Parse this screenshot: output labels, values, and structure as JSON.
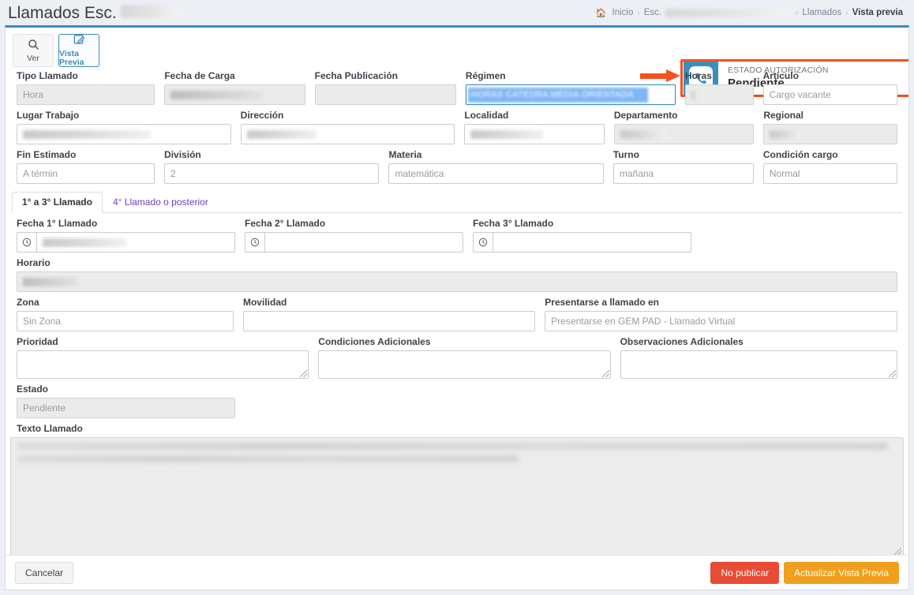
{
  "header": {
    "title_prefix": "Llamados Esc.",
    "title_redacted": true
  },
  "breadcrumb": {
    "home_icon": "home-icon",
    "items": [
      {
        "label": "Inicio",
        "active": false
      },
      {
        "label": "Esc.",
        "active": false,
        "redacted": true
      },
      {
        "label": "Llamados",
        "active": false
      },
      {
        "label": "Vista previa",
        "active": true
      }
    ],
    "separator": "›"
  },
  "toolbar": {
    "buttons": [
      {
        "icon": "search-icon",
        "label": "Ver",
        "active": false
      },
      {
        "icon": "edit-document-icon",
        "label": "Vista Previa",
        "active": true
      }
    ]
  },
  "status_callout": {
    "icon": "phone-icon",
    "label": "ESTADO AUTORIZACIÓN",
    "value": "Pendiente",
    "highlight_color": "#f4511e",
    "icon_bg_color": "#3c8dbc",
    "arrow_icon": "right-arrow-annotation"
  },
  "fields": {
    "tipo_llamado": {
      "label": "Tipo Llamado",
      "value": "Hora",
      "readonly": true
    },
    "fecha_carga": {
      "label": "Fecha de Carga",
      "value": "",
      "readonly": true,
      "redacted": true
    },
    "fecha_publicacion": {
      "label": "Fecha Publicación",
      "value": "",
      "readonly": true
    },
    "regimen": {
      "label": "Régimen",
      "value": "",
      "focused": true,
      "selected_text_redacted": true
    },
    "horas": {
      "label": "Horas",
      "value": "3",
      "readonly": true,
      "redacted": true
    },
    "articulo": {
      "label": "Artículo",
      "value": "Cargo vacante",
      "readonly": false
    },
    "lugar_trabajo": {
      "label": "Lugar Trabajo",
      "value": "",
      "redacted": true
    },
    "direccion": {
      "label": "Dirección",
      "value": "",
      "redacted": true
    },
    "localidad": {
      "label": "Localidad",
      "value": "",
      "redacted": true
    },
    "departamento": {
      "label": "Departamento",
      "value": "",
      "readonly": true,
      "redacted": true
    },
    "regional": {
      "label": "Regional",
      "value": "",
      "readonly": true,
      "redacted": true
    },
    "fin_estimado": {
      "label": "Fin Estimado",
      "value": "A términ"
    },
    "division": {
      "label": "División",
      "value": "2"
    },
    "materia": {
      "label": "Materia",
      "value": "matemática"
    },
    "turno": {
      "label": "Turno",
      "value": "mañana"
    },
    "condicion_cargo": {
      "label": "Condición cargo",
      "value": "Normal"
    },
    "fecha_1_llamado": {
      "label": "Fecha 1° Llamado",
      "value": "",
      "redacted": true,
      "icon": "clock-icon"
    },
    "fecha_2_llamado": {
      "label": "Fecha 2° Llamado",
      "value": "",
      "icon": "clock-icon"
    },
    "fecha_3_llamado": {
      "label": "Fecha 3° Llamado",
      "value": "",
      "icon": "clock-icon"
    },
    "horario": {
      "label": "Horario",
      "value": "",
      "readonly": true,
      "redacted": true
    },
    "zona": {
      "label": "Zona",
      "value": "Sin Zona"
    },
    "movilidad": {
      "label": "Movilidad",
      "value": ""
    },
    "presentarse": {
      "label": "Presentarse a llamado en",
      "value": "Presentarse en GEM PAD - Llamado Virtual"
    },
    "prioridad": {
      "label": "Prioridad",
      "value": ""
    },
    "condiciones_adicionales": {
      "label": "Condiciones Adicionales",
      "value": ""
    },
    "observaciones_adicionales": {
      "label": "Observaciones Adicionales",
      "value": ""
    },
    "estado": {
      "label": "Estado",
      "value": "Pendiente",
      "readonly": true
    },
    "texto_llamado": {
      "label": "Texto Llamado",
      "value": "",
      "readonly": true,
      "redacted": true
    }
  },
  "tabs": [
    {
      "label": "1° a 3° Llamado",
      "active": true
    },
    {
      "label": "4° Llamado o posterior",
      "active": false
    }
  ],
  "footer": {
    "cancel_label": "Cancelar",
    "no_publish_label": "No publicar",
    "update_label": "Actualizar Vista Previa",
    "no_publish_color": "#e94b35",
    "update_color": "#f0a01e"
  }
}
